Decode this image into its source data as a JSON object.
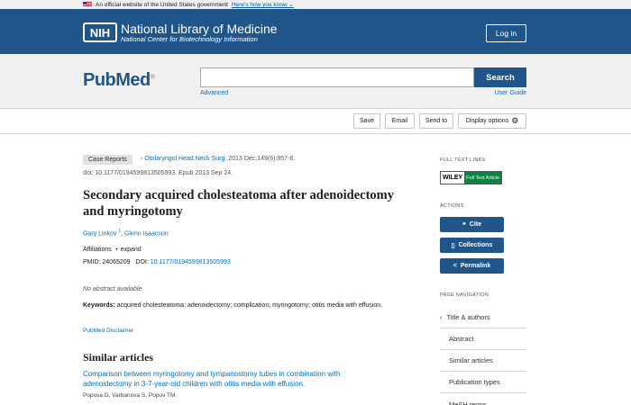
{
  "gov_banner": {
    "text": "An official website of the United States government",
    "link": "Here's how you know ⌄"
  },
  "nih": {
    "logo": "NIH",
    "title": "National Library of Medicine",
    "subtitle": "National Center for Biotechnology Information",
    "login": "Log in"
  },
  "search": {
    "logo_text": "PubMed",
    "logo_reg": "®",
    "value": "",
    "button": "Search",
    "advanced": "Advanced",
    "user_guide": "User Guide"
  },
  "toolbar": {
    "save": "Save",
    "email": "Email",
    "send_to": "Send to",
    "display": "Display options"
  },
  "article": {
    "type_badge": "Case Reports",
    "journal": "Otolaryngol Head Neck Surg.",
    "citation_rest": "2013 Dec;149(6):957-8.",
    "doi_line": "doi: 10.1177/0194599813505993. Epub 2013 Sep 24.",
    "title": "Secondary acquired cholesteatoma after adenoidectomy and myringotomy",
    "author1": "Gary Linkov",
    "author1_sup": "1",
    "author_sep": ", ",
    "author2": "Glenn Isaacson",
    "affiliations": "Affiliations",
    "expand": "+ expand",
    "pmid_label": "PMID: 24065209",
    "doi_label": "DOI:",
    "doi_link": "10.1177/0194599813505993",
    "no_abstract": "No abstract available",
    "keywords_label": "Keywords:",
    "keywords": " acquired cholesteatoma; adenoidectomy; complication; myringotomy; otitis media with effusion.",
    "disclaimer": "PubMed Disclaimer"
  },
  "similar": {
    "heading": "Similar articles",
    "item1_title": "Comparison between myringotomy and tympanostomy tubes in combination with adenoidectomy in 3-7-year-old children with otitis media with effusion.",
    "item1_authors": "Popova D, Varbanova S, Popov TM."
  },
  "sidebar": {
    "full_text_heading": "FULL TEXT LINKS",
    "wiley": "WILEY",
    "full_text_article": "Full Text Article",
    "actions_heading": "ACTIONS",
    "cite": "Cite",
    "collections": "Collections",
    "permalink": "Permalink",
    "page_nav_heading": "PAGE NAVIGATION",
    "nav": [
      "Title & authors",
      "Abstract",
      "Similar articles",
      "Publication types",
      "MeSH terms"
    ]
  },
  "colors": {
    "brand": "#20558a",
    "link": "#0071bc",
    "wiley_green": "#0a8442"
  }
}
